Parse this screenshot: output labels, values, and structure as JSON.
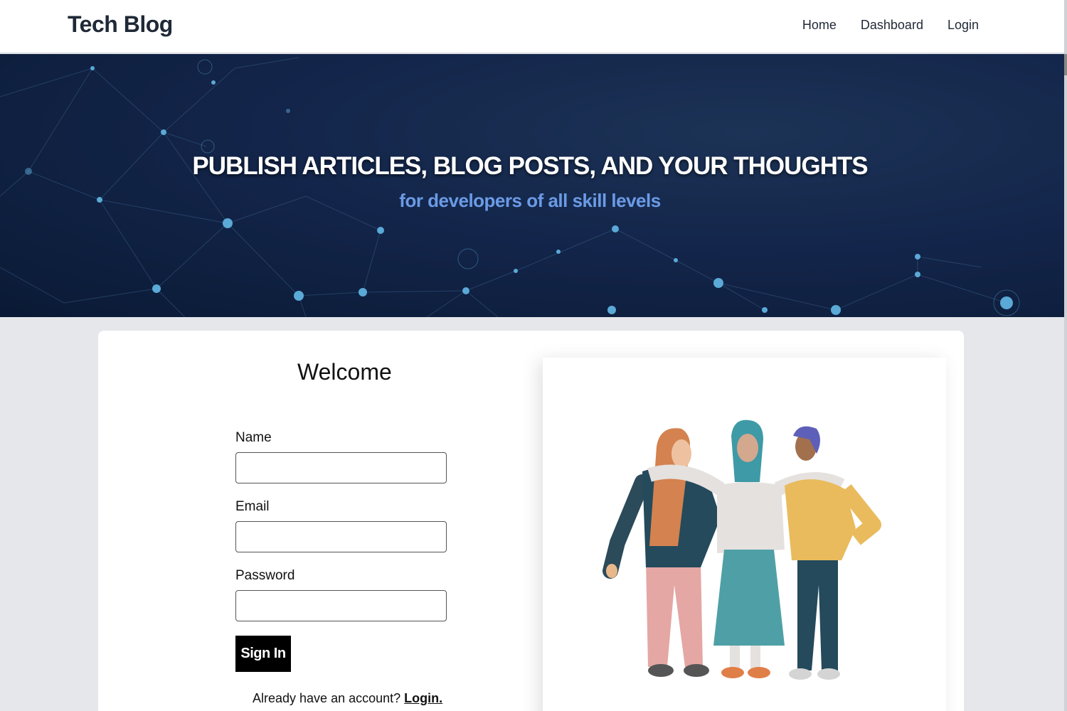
{
  "navbar": {
    "brand": "Tech Blog",
    "links": [
      "Home",
      "Dashboard",
      "Login"
    ]
  },
  "hero": {
    "title": "PUBLISH ARTICLES, BLOG POSTS, AND YOUR THOUGHTS",
    "subtitle": "for developers of all skill levels"
  },
  "form": {
    "heading": "Welcome",
    "fields": [
      {
        "label": "Name",
        "value": ""
      },
      {
        "label": "Email",
        "value": ""
      },
      {
        "label": "Password",
        "value": ""
      }
    ],
    "submit_label": "Sign In",
    "footer_text": "Already have an account?",
    "footer_link": "Login."
  },
  "colors": {
    "hero_bg": "#13254a",
    "subtitle": "#6b9be6",
    "button": "#000000",
    "page_bg": "#e5e7eb"
  },
  "icons": [
    "network-background",
    "people-illustration"
  ]
}
